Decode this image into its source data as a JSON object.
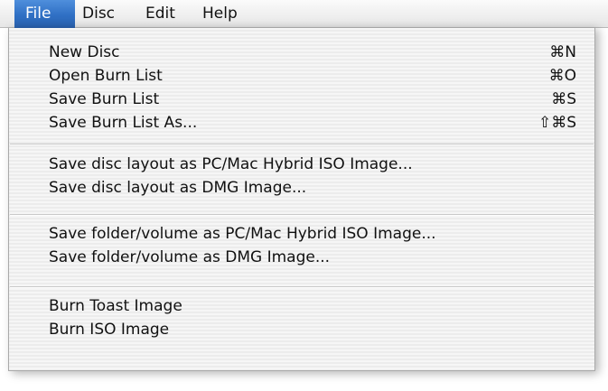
{
  "menubar": {
    "items": [
      {
        "label": "File",
        "active": true
      },
      {
        "label": "Disc",
        "active": false
      },
      {
        "label": "Edit",
        "active": false
      },
      {
        "label": "Help",
        "active": false
      }
    ]
  },
  "menu": {
    "groups": [
      [
        {
          "label": "New Disc",
          "shortcut": "⌘N"
        },
        {
          "label": "Open Burn List",
          "shortcut": "⌘O"
        },
        {
          "label": "Save Burn List",
          "shortcut": "⌘S"
        },
        {
          "label": "Save Burn List As...",
          "shortcut": "⇧⌘S"
        }
      ],
      [
        {
          "label": "Save disc layout as PC/Mac Hybrid ISO Image...",
          "shortcut": ""
        },
        {
          "label": "Save disc layout as DMG Image...",
          "shortcut": ""
        }
      ],
      [
        {
          "label": "Save folder/volume as PC/Mac Hybrid ISO Image...",
          "shortcut": ""
        },
        {
          "label": "Save folder/volume as DMG Image...",
          "shortcut": ""
        }
      ],
      [
        {
          "label": "Burn Toast Image",
          "shortcut": ""
        },
        {
          "label": "Burn ISO Image",
          "shortcut": ""
        }
      ]
    ]
  },
  "colors": {
    "highlight": "#2f6fc4",
    "menu_text": "#111111",
    "separator": "#c9c9c9"
  }
}
